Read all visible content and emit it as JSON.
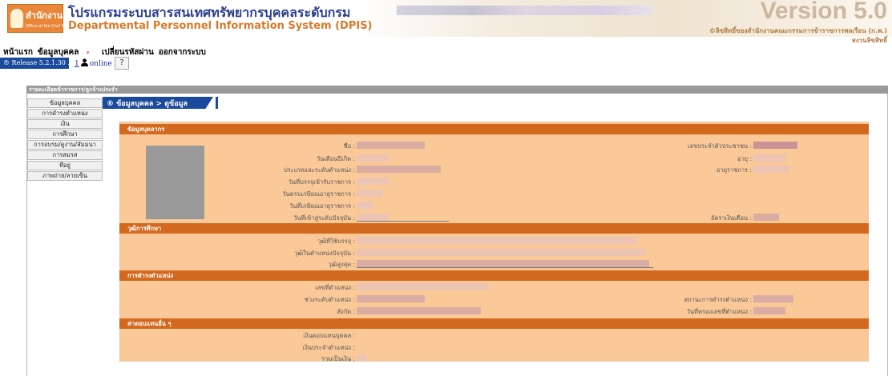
{
  "banner": {
    "logo_main": "สำนักงาน ก.พ.",
    "logo_sub": "Office of the Civil Service Commission",
    "title_th": "โปรแกรมระบบสารสนเทศทรัพยากรบุคคลระดับกรม",
    "title_en": "Departmental Personnel Information System (DPIS)",
    "version": "Version 5.0",
    "copyright_line1": "©ลิขสิทธิ์ของสำนักงานคณะกรรมการข้าราชการพลเรือน (ก.พ.)",
    "copyright_line2": "สงวนลิขสิทธิ์"
  },
  "topmenu": {
    "home": "หน้าแรก",
    "personnel": "ข้อมูลบุคคล",
    "change_password": "เปลี่ยนรหัสผ่าน",
    "logout": "ออกจากระบบ",
    "caret": "▾"
  },
  "status": {
    "release": "® Release 5.2.1.30 ....",
    "online_count": "1",
    "online_label": "online",
    "help": "?"
  },
  "frame": {
    "header": "รายละเอียดข้าราชการ/ลูกจ้างประจำ"
  },
  "sidebar": {
    "items": [
      {
        "label": "ข้อมูลบุคคล"
      },
      {
        "label": "การดำรงตำแหน่ง"
      },
      {
        "label": "เงิน"
      },
      {
        "label": "การศึกษา"
      },
      {
        "label": "การอบรม/ดูงาน/สัมมนา"
      },
      {
        "label": "การสมรส"
      },
      {
        "label": "ที่อยู่"
      },
      {
        "label": "ภาพถ่าย/ลายเซ็น"
      }
    ]
  },
  "breadcrumb": "® ข้อมูลบุคคล > ดูข้อมูล",
  "sections": {
    "personal": {
      "title": "ข้อมูลบุคลากร",
      "labels": {
        "name": "ชื่อ :",
        "birthdate": "วันเดือนปีเกิด :",
        "position_type": "ประเภทและระดับตำแหน่ง :",
        "appointed_date": "วันที่บรรจุเข้ารับราชการ :",
        "retire_age_date": "วันครบเกษียณอายุราชการ :",
        "retire_date": "วันที่เกษียณอายุราชการ :",
        "current_level_date": "วันที่เข้าสู่ระดับปัจจุบัน :",
        "citizen_id": "เลขประจำตัวประชาชน :",
        "age": "อายุ :",
        "service_years": "อายุราชการ :",
        "salary": "อัตราเงินเดือน :"
      }
    },
    "education": {
      "title": "วุฒิการศึกษา",
      "labels": {
        "entry_degree": "วุฒิที่ใช้บรรจุ :",
        "current_degree": "วุฒิในตำแหน่งปัจจุบัน :",
        "highest_degree": "วุฒิสูงสุด :"
      }
    },
    "position": {
      "title": "การดำรงตำแหน่ง",
      "labels": {
        "position_no": "เลขที่ตำแหน่ง :",
        "level_range": "ช่วงระดับตำแหน่ง :",
        "affiliation": "สังกัด :",
        "status": "สถานะการดำรงตำแหน่ง :",
        "hold_date": "วันที่ครองเลขที่ตำแหน่ง :"
      }
    },
    "compensation": {
      "title": "ค่าตอบแทนอื่น ๆ",
      "labels": {
        "personal_comp": "เงินตอบแทนบุคคล :",
        "position_allowance": "เงินประจำตำแหน่ง :",
        "total": "รวมเป็นเงิน :"
      }
    }
  }
}
